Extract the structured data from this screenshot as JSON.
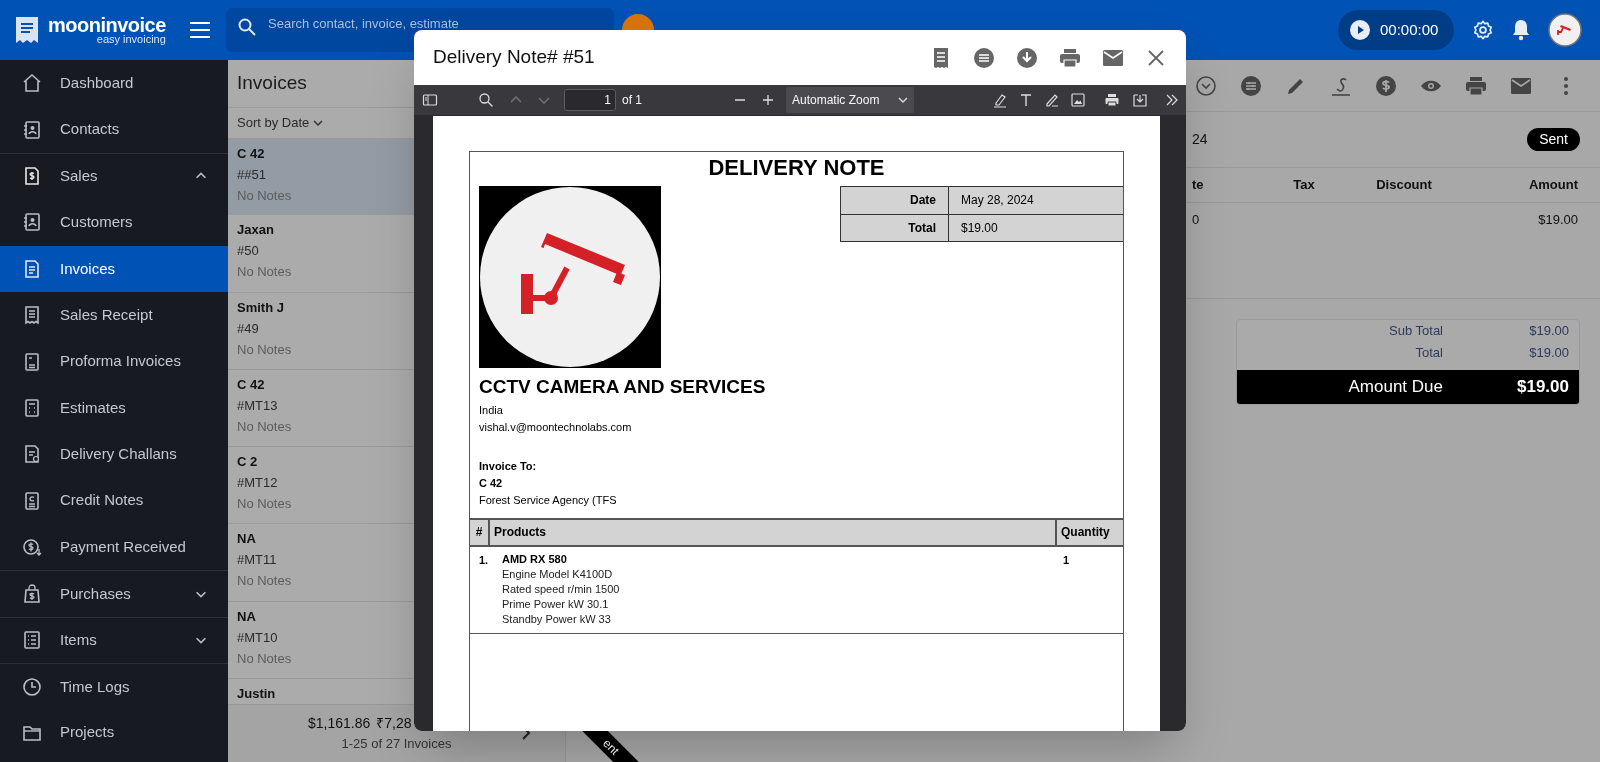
{
  "topbar": {
    "logo": {
      "name": "mooninvoice",
      "tagline": "easy invoicing"
    },
    "search": {
      "placeholder": "Search contact, invoice, estimate"
    },
    "timer": "00:00:00"
  },
  "sidebar": {
    "items": [
      {
        "label": "Dashboard",
        "kind": "link",
        "selected": false
      },
      {
        "label": "Contacts",
        "kind": "link",
        "selected": false
      },
      {
        "label": "Sales",
        "kind": "group",
        "selected": false,
        "expanded": true,
        "children": [
          {
            "label": "Customers",
            "kind": "link",
            "selected": false
          },
          {
            "label": "Invoices",
            "kind": "link",
            "selected": true
          },
          {
            "label": "Sales Receipt",
            "kind": "link",
            "selected": false
          },
          {
            "label": "Proforma Invoices",
            "kind": "link",
            "selected": false
          },
          {
            "label": "Estimates",
            "kind": "link",
            "selected": false
          },
          {
            "label": "Delivery Challans",
            "kind": "link",
            "selected": false
          },
          {
            "label": "Credit Notes",
            "kind": "link",
            "selected": false
          },
          {
            "label": "Payment Received",
            "kind": "link",
            "selected": false
          }
        ]
      },
      {
        "label": "Purchases",
        "kind": "group",
        "selected": false,
        "expanded": false
      },
      {
        "label": "Items",
        "kind": "group",
        "selected": false,
        "expanded": false
      },
      {
        "label": "Time Logs",
        "kind": "link",
        "selected": false
      },
      {
        "label": "Projects",
        "kind": "link",
        "selected": false
      }
    ]
  },
  "invoice_list": {
    "title": "Invoices",
    "sort": "Sort by Date",
    "items": [
      {
        "name": "C 42",
        "number": "##51",
        "notes": "No Notes",
        "selected": true
      },
      {
        "name": "Jaxan",
        "number": "#50",
        "notes": "No Notes",
        "selected": false
      },
      {
        "name": "Smith J",
        "number": "#49",
        "notes": "No Notes",
        "selected": false
      },
      {
        "name": "C 42",
        "number": "#MT13",
        "notes": "No Notes",
        "selected": false
      },
      {
        "name": "C 2",
        "number": "#MT12",
        "notes": "No Notes",
        "selected": false
      },
      {
        "name": "NA",
        "number": "#MT11",
        "notes": "No Notes",
        "selected": false
      },
      {
        "name": "NA",
        "number": "#MT10",
        "notes": "No Notes",
        "selected": false
      },
      {
        "name": "Justin",
        "selected": false
      }
    ],
    "footer": {
      "totals": [
        "$1,161.86",
        "₹7,28"
      ],
      "range": "1-25 of 27 Invoices"
    }
  },
  "detail": {
    "date": "24",
    "status": "Sent",
    "table": {
      "columns": [
        "te",
        "Tax",
        "Discount",
        "Amount"
      ],
      "rows": [
        {
          "column_1": "0",
          "amount": "$19.00"
        }
      ]
    },
    "totals": {
      "rows": [
        {
          "label": "Sub Total",
          "value": "$19.00"
        },
        {
          "label": "Total",
          "value": "$19.00"
        }
      ],
      "amount_due": {
        "label": "Amount Due",
        "value": "$19.00"
      }
    },
    "ribbon": "ent"
  },
  "modal": {
    "title": "Delivery Note# #51",
    "pdf_toolbar": {
      "page": "1",
      "page_count": "of 1",
      "zoom": "Automatic Zoom"
    },
    "document": {
      "heading": "DELIVERY NOTE",
      "meta": [
        {
          "label": "Date",
          "value": "May 28, 2024"
        },
        {
          "label": "Total",
          "value": "$19.00"
        }
      ],
      "company": {
        "name": "CCTV CAMERA AND SERVICES",
        "country": "India",
        "email": "vishal.v@moontechnolabs.com"
      },
      "bill_to": {
        "label": "Invoice To:",
        "name": "C 42",
        "address": "Forest Service Agency (TFS"
      },
      "products": {
        "columns": [
          "#",
          "Products",
          "Quantity"
        ],
        "rows": [
          {
            "index": "1.",
            "name": "AMD RX 580",
            "details": [
              "Engine Model K4100D",
              "Rated speed r/min 1500",
              "Prime Power kW 30.1",
              "Standby Power kW 33"
            ],
            "quantity": "1"
          }
        ]
      }
    }
  }
}
